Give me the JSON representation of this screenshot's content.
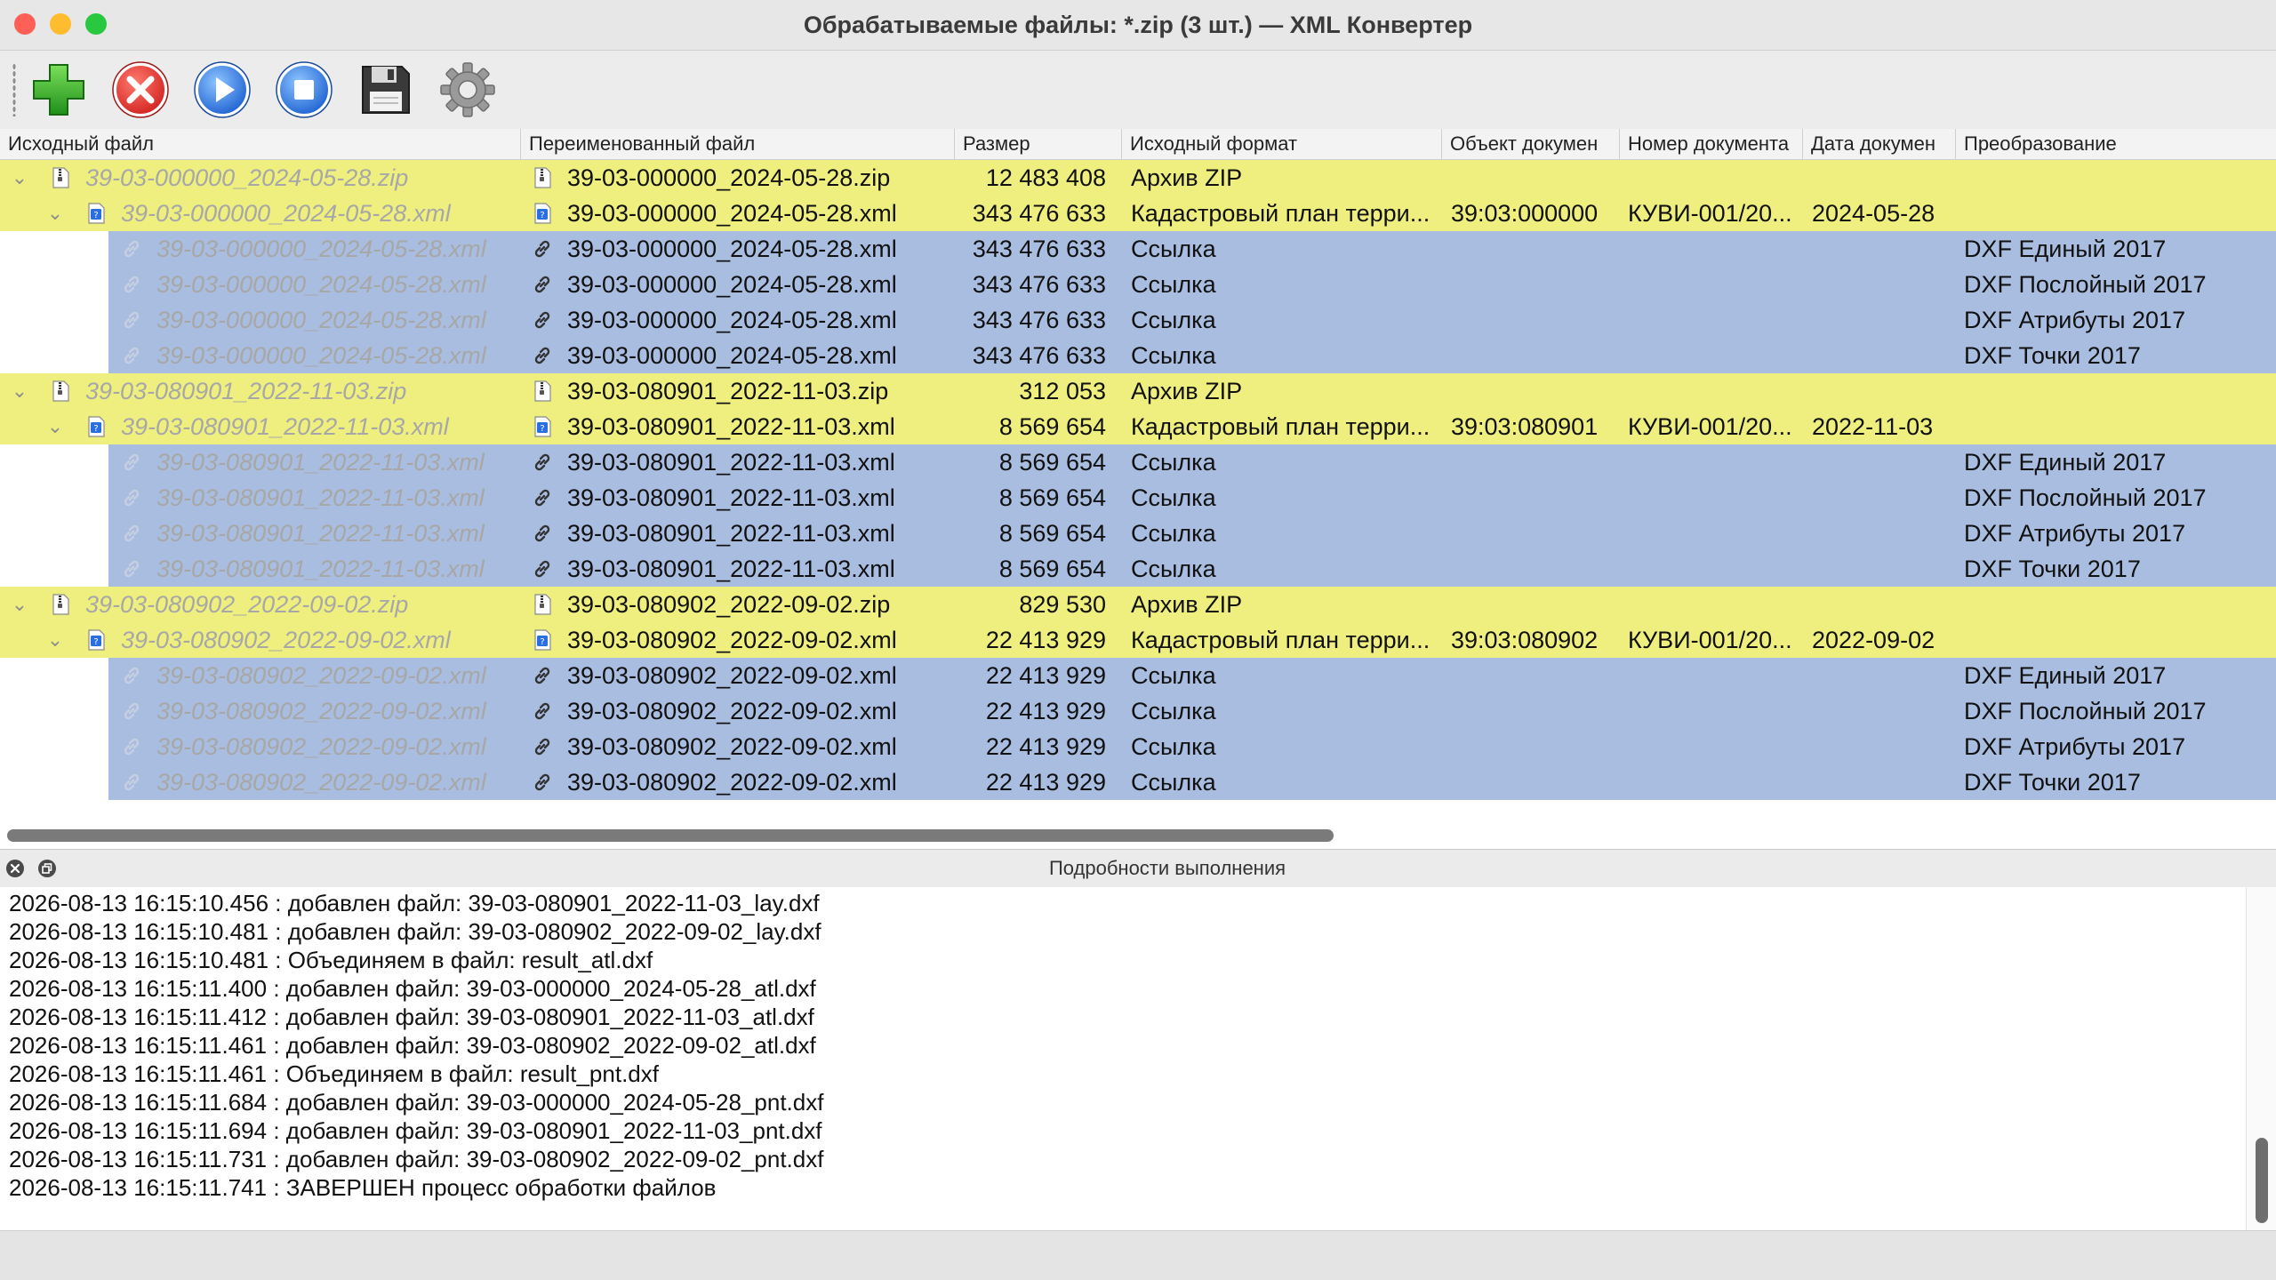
{
  "window": {
    "title": "Обрабатываемые файлы: *.zip (3 шт.) — XML Конвертер"
  },
  "colors": {
    "zip_row": "#efef80",
    "link_row": "#a9bde0",
    "traffic_close": "#fe5f57",
    "traffic_minimize": "#febc2e",
    "traffic_zoom": "#28c840"
  },
  "toolbar": {
    "buttons": [
      {
        "name": "add-button",
        "icon": "green-plus-icon"
      },
      {
        "name": "remove-button",
        "icon": "red-x-icon"
      },
      {
        "name": "start-button",
        "icon": "blue-play-icon"
      },
      {
        "name": "stop-button",
        "icon": "blue-stop-icon"
      },
      {
        "name": "save-button",
        "icon": "floppy-disk-icon"
      },
      {
        "name": "settings-button",
        "icon": "gear-icon"
      }
    ]
  },
  "table": {
    "columns": [
      "Исходный файл",
      "Переименованный файл",
      "Размер",
      "Исходный формат",
      "Объект докумен",
      "Номер документа",
      "Дата докумен",
      "Преобразование"
    ],
    "rows": [
      {
        "kind": "zip",
        "level": 0,
        "source": "39-03-000000_2024-05-28.zip",
        "renamed": "39-03-000000_2024-05-28.zip",
        "size": "12 483 408",
        "format": "Архив ZIP",
        "object": "",
        "number": "",
        "date": "",
        "conversion": ""
      },
      {
        "kind": "xml",
        "level": 1,
        "source": "39-03-000000_2024-05-28.xml",
        "renamed": "39-03-000000_2024-05-28.xml",
        "size": "343 476 633",
        "format": "Кадастровый план терри...",
        "object": "39:03:000000",
        "number": "КУВИ-001/20...",
        "date": "2024-05-28",
        "conversion": ""
      },
      {
        "kind": "link",
        "level": 2,
        "source": "39-03-000000_2024-05-28.xml",
        "renamed": "39-03-000000_2024-05-28.xml",
        "size": "343 476 633",
        "format": "Ссылка",
        "object": "",
        "number": "",
        "date": "",
        "conversion": "DXF Единый 2017"
      },
      {
        "kind": "link",
        "level": 2,
        "source": "39-03-000000_2024-05-28.xml",
        "renamed": "39-03-000000_2024-05-28.xml",
        "size": "343 476 633",
        "format": "Ссылка",
        "object": "",
        "number": "",
        "date": "",
        "conversion": "DXF Послойный 2017"
      },
      {
        "kind": "link",
        "level": 2,
        "source": "39-03-000000_2024-05-28.xml",
        "renamed": "39-03-000000_2024-05-28.xml",
        "size": "343 476 633",
        "format": "Ссылка",
        "object": "",
        "number": "",
        "date": "",
        "conversion": "DXF Атрибуты 2017"
      },
      {
        "kind": "link",
        "level": 2,
        "source": "39-03-000000_2024-05-28.xml",
        "renamed": "39-03-000000_2024-05-28.xml",
        "size": "343 476 633",
        "format": "Ссылка",
        "object": "",
        "number": "",
        "date": "",
        "conversion": "DXF Точки 2017"
      },
      {
        "kind": "zip",
        "level": 0,
        "source": "39-03-080901_2022-11-03.zip",
        "renamed": "39-03-080901_2022-11-03.zip",
        "size": "312 053",
        "format": "Архив ZIP",
        "object": "",
        "number": "",
        "date": "",
        "conversion": ""
      },
      {
        "kind": "xml",
        "level": 1,
        "source": "39-03-080901_2022-11-03.xml",
        "renamed": "39-03-080901_2022-11-03.xml",
        "size": "8 569 654",
        "format": "Кадастровый план терри...",
        "object": "39:03:080901",
        "number": "КУВИ-001/20...",
        "date": "2022-11-03",
        "conversion": ""
      },
      {
        "kind": "link",
        "level": 2,
        "source": "39-03-080901_2022-11-03.xml",
        "renamed": "39-03-080901_2022-11-03.xml",
        "size": "8 569 654",
        "format": "Ссылка",
        "object": "",
        "number": "",
        "date": "",
        "conversion": "DXF Единый 2017"
      },
      {
        "kind": "link",
        "level": 2,
        "source": "39-03-080901_2022-11-03.xml",
        "renamed": "39-03-080901_2022-11-03.xml",
        "size": "8 569 654",
        "format": "Ссылка",
        "object": "",
        "number": "",
        "date": "",
        "conversion": "DXF Послойный 2017"
      },
      {
        "kind": "link",
        "level": 2,
        "source": "39-03-080901_2022-11-03.xml",
        "renamed": "39-03-080901_2022-11-03.xml",
        "size": "8 569 654",
        "format": "Ссылка",
        "object": "",
        "number": "",
        "date": "",
        "conversion": "DXF Атрибуты 2017"
      },
      {
        "kind": "link",
        "level": 2,
        "source": "39-03-080901_2022-11-03.xml",
        "renamed": "39-03-080901_2022-11-03.xml",
        "size": "8 569 654",
        "format": "Ссылка",
        "object": "",
        "number": "",
        "date": "",
        "conversion": "DXF Точки 2017"
      },
      {
        "kind": "zip",
        "level": 0,
        "source": "39-03-080902_2022-09-02.zip",
        "renamed": "39-03-080902_2022-09-02.zip",
        "size": "829 530",
        "format": "Архив ZIP",
        "object": "",
        "number": "",
        "date": "",
        "conversion": ""
      },
      {
        "kind": "xml",
        "level": 1,
        "source": "39-03-080902_2022-09-02.xml",
        "renamed": "39-03-080902_2022-09-02.xml",
        "size": "22 413 929",
        "format": "Кадастровый план терри...",
        "object": "39:03:080902",
        "number": "КУВИ-001/20...",
        "date": "2022-09-02",
        "conversion": ""
      },
      {
        "kind": "link",
        "level": 2,
        "source": "39-03-080902_2022-09-02.xml",
        "renamed": "39-03-080902_2022-09-02.xml",
        "size": "22 413 929",
        "format": "Ссылка",
        "object": "",
        "number": "",
        "date": "",
        "conversion": "DXF Единый 2017"
      },
      {
        "kind": "link",
        "level": 2,
        "source": "39-03-080902_2022-09-02.xml",
        "renamed": "39-03-080902_2022-09-02.xml",
        "size": "22 413 929",
        "format": "Ссылка",
        "object": "",
        "number": "",
        "date": "",
        "conversion": "DXF Послойный 2017"
      },
      {
        "kind": "link",
        "level": 2,
        "source": "39-03-080902_2022-09-02.xml",
        "renamed": "39-03-080902_2022-09-02.xml",
        "size": "22 413 929",
        "format": "Ссылка",
        "object": "",
        "number": "",
        "date": "",
        "conversion": "DXF Атрибуты 2017"
      },
      {
        "kind": "link",
        "level": 2,
        "source": "39-03-080902_2022-09-02.xml",
        "renamed": "39-03-080902_2022-09-02.xml",
        "size": "22 413 929",
        "format": "Ссылка",
        "object": "",
        "number": "",
        "date": "",
        "conversion": "DXF Точки 2017"
      }
    ]
  },
  "details": {
    "title": "Подробности выполнения",
    "lines": [
      "2026-08-13 16:15:10.456 : добавлен файл: 39-03-080901_2022-11-03_lay.dxf",
      "2026-08-13 16:15:10.481 : добавлен файл: 39-03-080902_2022-09-02_lay.dxf",
      "2026-08-13 16:15:10.481 : Объединяем в файл: result_atl.dxf",
      "2026-08-13 16:15:11.400 : добавлен файл: 39-03-000000_2024-05-28_atl.dxf",
      "2026-08-13 16:15:11.412 : добавлен файл: 39-03-080901_2022-11-03_atl.dxf",
      "2026-08-13 16:15:11.461 : добавлен файл: 39-03-080902_2022-09-02_atl.dxf",
      "2026-08-13 16:15:11.461 : Объединяем в файл: result_pnt.dxf",
      "2026-08-13 16:15:11.684 : добавлен файл: 39-03-000000_2024-05-28_pnt.dxf",
      "2026-08-13 16:15:11.694 : добавлен файл: 39-03-080901_2022-11-03_pnt.dxf",
      "2026-08-13 16:15:11.731 : добавлен файл: 39-03-080902_2022-09-02_pnt.dxf",
      "2026-08-13 16:15:11.741 : ЗАВЕРШЕН процесс обработки файлов"
    ]
  }
}
